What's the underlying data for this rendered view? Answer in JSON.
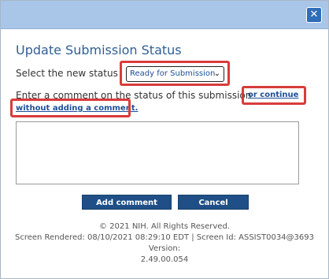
{
  "dialog": {
    "title": "Update Submission Status",
    "close_glyph": "✕",
    "select_label": "Select the new status",
    "status_value": "Ready for Submission",
    "chevron_glyph": "⌄",
    "comment_label": "Enter a comment on the status of this submission",
    "continue_link_part1": "or continue",
    "continue_link_part2": "without adding a comment.",
    "comment_value": "",
    "add_button_label": "Add comment",
    "cancel_button_label": "Cancel"
  },
  "footer": {
    "copyright": "© 2021 NIH. All Rights Reserved.",
    "screen_info": "Screen Rendered: 08/10/2021 08:29:10 EDT | Screen Id: ASSIST0034@3693",
    "version_label": "Version:",
    "version_value": "2.49.00.054"
  },
  "colors": {
    "titlebar": "#a9c6e8",
    "accent": "#2f5f93",
    "button": "#1f4f86",
    "highlight": "#d93b3b"
  }
}
